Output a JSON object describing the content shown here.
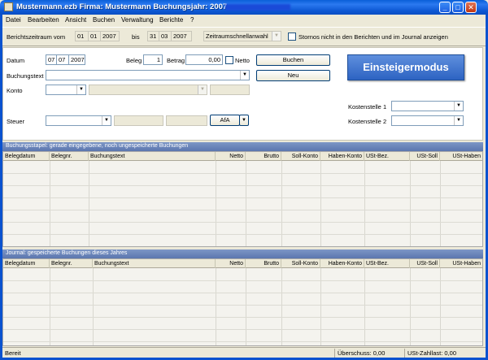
{
  "window": {
    "title": "Mustermann.ezb   Firma: Mustermann   Buchungsjahr: 2007"
  },
  "menu": [
    "Datei",
    "Bearbeiten",
    "Ansicht",
    "Buchen",
    "Verwaltung",
    "Berichte",
    "?"
  ],
  "toolbar": {
    "period_label": "Berichtszeitraum vom",
    "from_day": "01",
    "from_month": "01",
    "from_year": "2007",
    "to_label": "bis",
    "to_day": "31",
    "to_month": "03",
    "to_year": "2007",
    "quick_select": "Zeitraumschnellanwahl",
    "hide_reversals_label": "Stornos nicht in den Berichten und im Journal anzeigen",
    "hide_reversals_checked": false
  },
  "form": {
    "date_label": "Datum",
    "date_day": "07",
    "date_month": "07",
    "date_year": "2007",
    "receipt_label": "Beleg",
    "receipt_value": "1",
    "amount_label": "Betrag",
    "amount_value": "0,00",
    "net_label": "Netto",
    "net_checked": false,
    "booking_button": "Buchen",
    "new_button": "Neu",
    "text_label": "Buchungstext",
    "text_value": "",
    "account_label": "Konto",
    "account_value": "",
    "tax_label": "Steuer",
    "tax_value": "",
    "afa_button": "AfA",
    "cost_center1_label": "Kostenstelle 1",
    "cost_center2_label": "Kostenstelle 2",
    "mode_button": "Einsteigermodus"
  },
  "batch": {
    "title": "Buchungsstapel: gerade eingegebene, noch ungespeicherte Buchungen",
    "columns": [
      "Belegdatum",
      "Belegnr.",
      "Buchungstext",
      "Netto",
      "Brutto",
      "Soll-Konto",
      "Haben-Konto",
      "USt-Bez.",
      "USt-Soll",
      "USt-Haben"
    ],
    "rows": []
  },
  "journal": {
    "title": "Journal: gespeicherte Buchungen dieses Jahres",
    "columns": [
      "Belegdatum",
      "Belegnr.",
      "Buchungstext",
      "Netto",
      "Brutto",
      "Soll-Konto",
      "Haben-Konto",
      "USt-Bez.",
      "USt-Soll",
      "USt-Haben"
    ],
    "rows": []
  },
  "status": {
    "state": "Bereit",
    "surplus": "Überschuss: 0,00",
    "vat_due": "USt-Zahllast: 0,00"
  },
  "colors": {
    "titlebar": "#0a5fd8",
    "section_header": "#6883b9",
    "mode_button": "#3c6fcb"
  }
}
